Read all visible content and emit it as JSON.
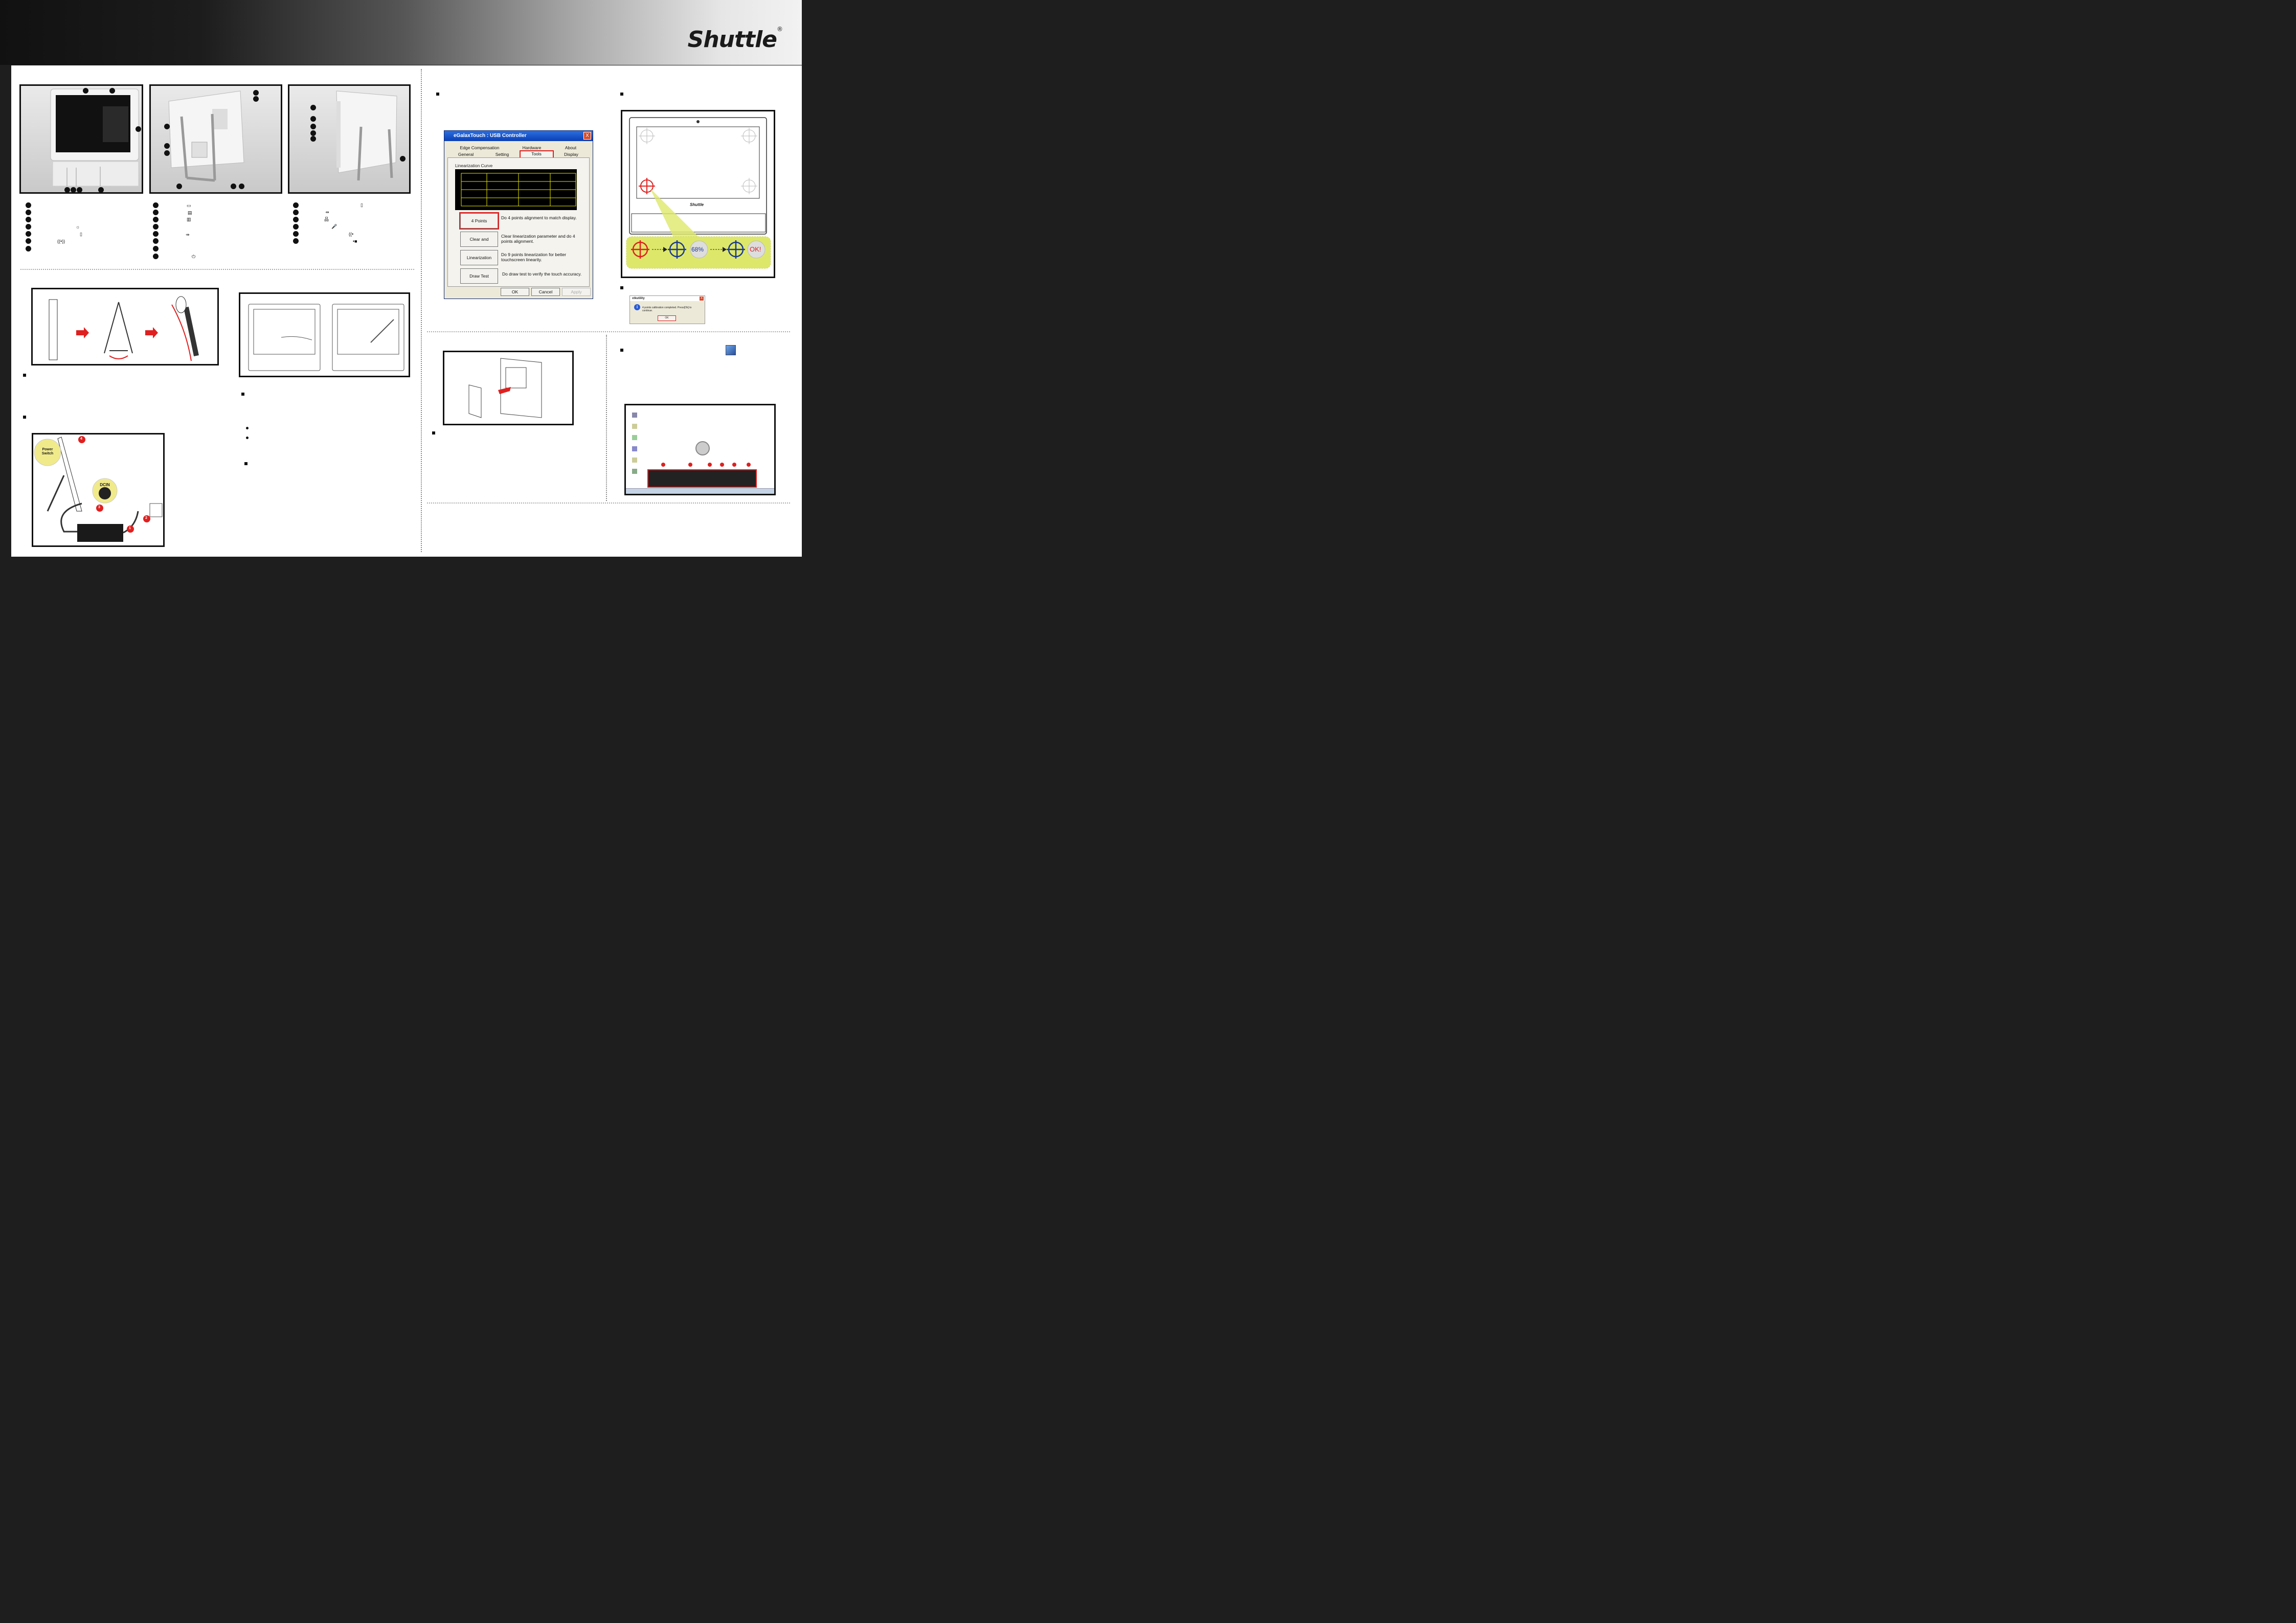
{
  "brand": {
    "logo": "Shuttle",
    "mark": "®"
  },
  "dialog": {
    "title": "eGalaxTouch : USB Controller",
    "close": "X",
    "tabs_back": [
      "Edge Compensation",
      "Hardware",
      "About"
    ],
    "tabs_front": [
      "General",
      "Setting",
      "Tools",
      "Display"
    ],
    "active_tab": "Tools",
    "section": "Linearization Curve",
    "buttons": [
      {
        "label": "4 Points Calibration",
        "desc": "Do 4 points alignment to match display."
      },
      {
        "label": "Clear and Calibrate",
        "desc": "Clear linearization parameter and do 4 points alignment."
      },
      {
        "label": "Linearization",
        "desc": "Do 9 points linearization for better touchscreen linearity."
      },
      {
        "label": "Draw Test",
        "desc": "Do draw test to verify the touch accuracy."
      }
    ],
    "ok": "OK",
    "cancel": "Cancel",
    "apply": "Apply"
  },
  "monitor_illustration": {
    "brand": "Shuttle",
    "calibration_percent": "68%",
    "ok_text": "OK!"
  },
  "msgbox": {
    "title": "xtkutility",
    "close": "X",
    "message": "4 points calibration completed. Press[Ok] to continue.",
    "ok": "OK"
  },
  "power_diagram": {
    "power_switch": "Power Switch",
    "dcin": "DCIN",
    "steps": [
      "1",
      "2",
      "3",
      "4"
    ]
  },
  "accent": {
    "red": "#e02020",
    "highlight_yellow": "#dde86a",
    "graph_yellow": "#e6e600",
    "navy": "#1b3a8f"
  }
}
